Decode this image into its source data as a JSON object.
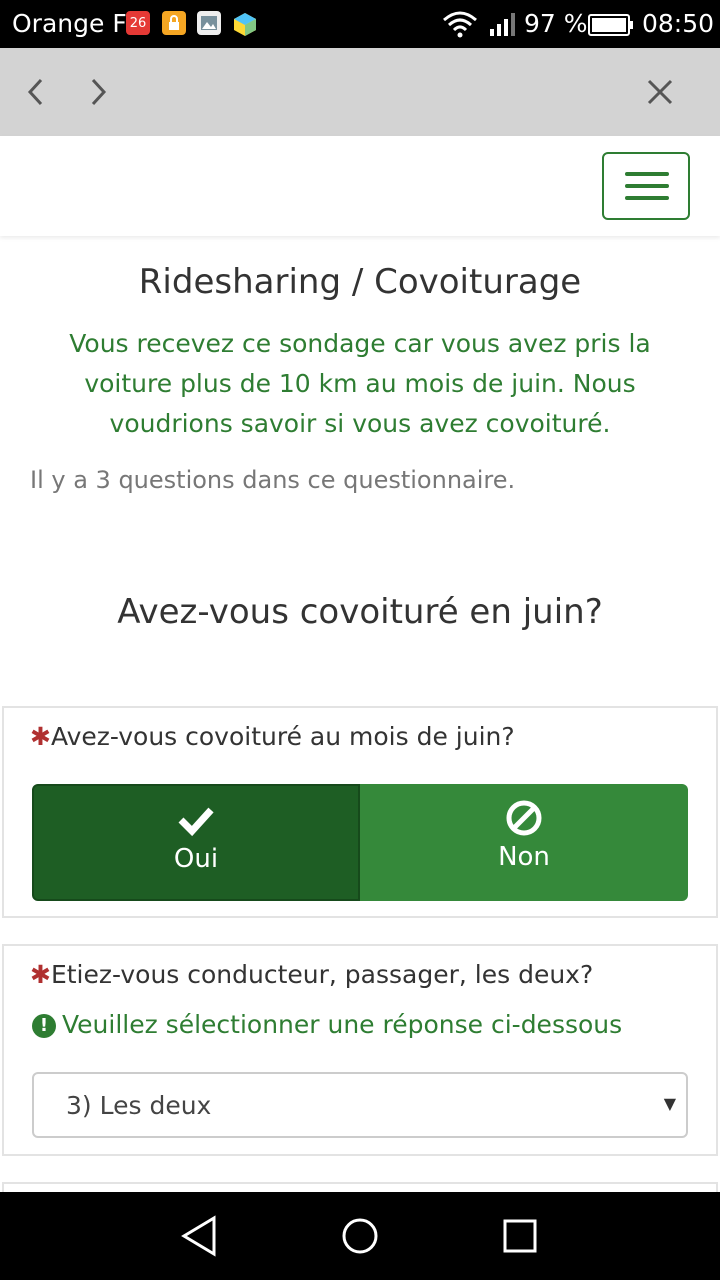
{
  "status_bar": {
    "carrier": "Orange F",
    "battery": "97 %",
    "time": "08:50",
    "icons": [
      "calendar-icon",
      "lock-app-icon",
      "gallery-icon",
      "cube-app-icon",
      "wifi-icon",
      "signal-icon",
      "battery-icon"
    ]
  },
  "browser": {
    "back_icon": "chevron-left-icon",
    "forward_icon": "chevron-right-icon",
    "close_icon": "close-icon"
  },
  "page": {
    "title": "Ridesharing / Covoiturage",
    "intro": "Vous recevez ce sondage car vous avez pris la voiture plus de 10 km au mois de juin. Nous voudrions savoir si vous avez covoituré.",
    "question_count": "Il y a 3 questions dans ce questionnaire.",
    "group_title": "Avez-vous covoituré en juin?"
  },
  "question1": {
    "required_mark": "✱",
    "text": "Avez-vous covoituré au mois de juin?",
    "options": [
      {
        "label": "Oui",
        "icon": "check-icon",
        "selected": true
      },
      {
        "label": "Non",
        "icon": "ban-icon",
        "selected": false
      }
    ]
  },
  "question2": {
    "required_mark": "✱",
    "text": "Etiez-vous conducteur, passager, les deux?",
    "warning": "Veuillez sélectionner une réponse ci-dessous",
    "selected_value": "3) Les deux"
  },
  "colors": {
    "accent": "#2e7d32",
    "selected_button": "#1e5e24",
    "button": "#35893a",
    "required": "#b03030"
  },
  "android_nav": [
    "back-triangle-icon",
    "home-circle-icon",
    "recents-square-icon"
  ]
}
